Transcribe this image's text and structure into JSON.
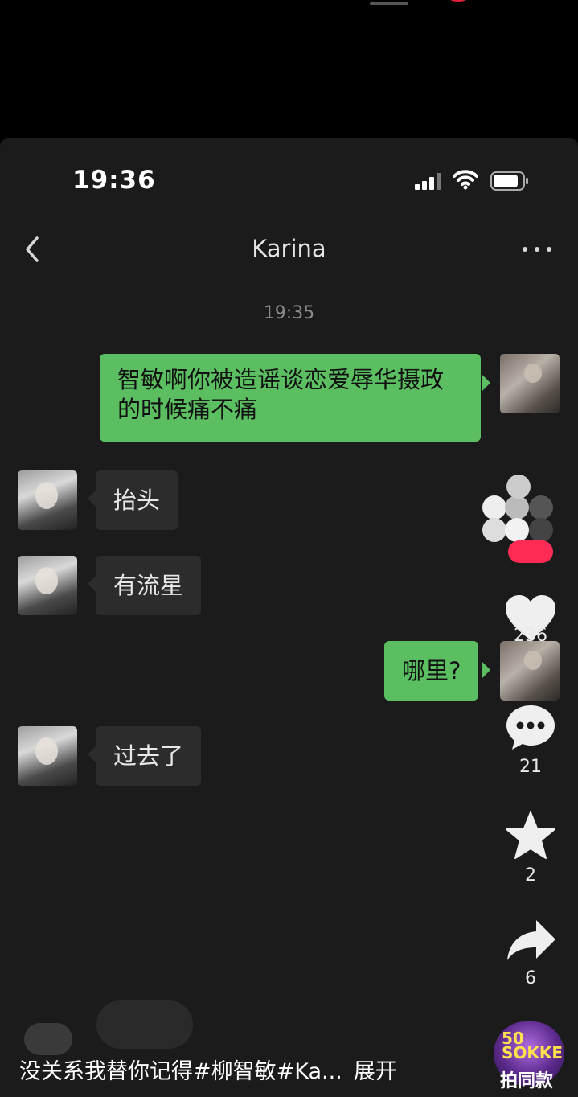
{
  "status_bar": {
    "time": "19:36"
  },
  "nav": {
    "title": "Karina"
  },
  "chat": {
    "timestamp": "19:35",
    "messages": [
      {
        "from": "me",
        "text": "智敏啊你被造谣谈恋爱辱华摄政的时候痛不痛"
      },
      {
        "from": "them",
        "text": "抬头"
      },
      {
        "from": "them",
        "text": "有流星"
      },
      {
        "from": "me",
        "text": "哪里?"
      },
      {
        "from": "them",
        "text": "过去了"
      }
    ]
  },
  "actions": {
    "likes": "236",
    "comments": "21",
    "favorites": "2",
    "shares": "6"
  },
  "caption": {
    "text": "没关系我替你记得#柳智敏#Ka...",
    "expand": "展开"
  },
  "sticker": {
    "line1": "50",
    "line2": "SOKKE",
    "label": "拍同款"
  },
  "colors": {
    "my_bubble": "#5bbf62",
    "their_bubble": "#2c2c2c",
    "background": "#1b1b1b",
    "follow": "#ff2b55"
  }
}
